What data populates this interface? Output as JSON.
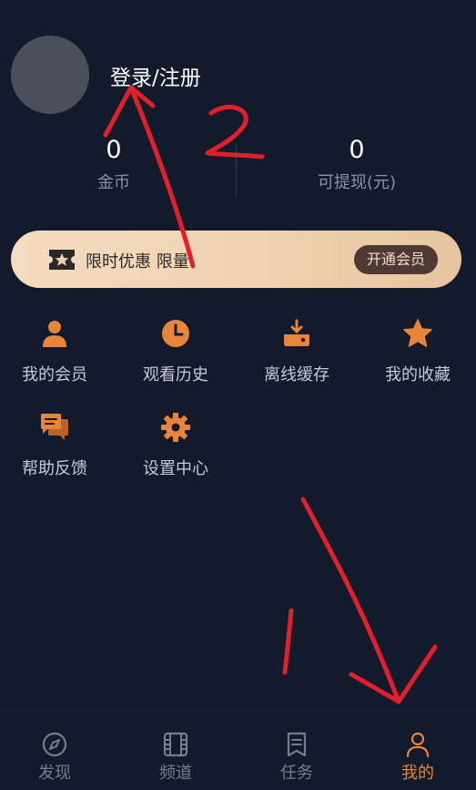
{
  "profile": {
    "login_label": "登录/注册"
  },
  "stats": {
    "coins": {
      "value": "0",
      "label": "金币"
    },
    "cash": {
      "value": "0",
      "label": "可提现(元)"
    }
  },
  "banner": {
    "promo_text": "限时优惠 限量",
    "button_label": "开通会员"
  },
  "menu": [
    {
      "label": "我的会员",
      "icon": "user-icon"
    },
    {
      "label": "观看历史",
      "icon": "clock-icon"
    },
    {
      "label": "离线缓存",
      "icon": "download-icon"
    },
    {
      "label": "我的收藏",
      "icon": "star-icon"
    },
    {
      "label": "帮助反馈",
      "icon": "chat-icon"
    },
    {
      "label": "设置中心",
      "icon": "gear-icon"
    }
  ],
  "tabs": [
    {
      "label": "发现",
      "icon": "compass-icon",
      "active": false
    },
    {
      "label": "频道",
      "icon": "film-icon",
      "active": false
    },
    {
      "label": "任务",
      "icon": "task-icon",
      "active": false
    },
    {
      "label": "我的",
      "icon": "profile-icon",
      "active": true
    }
  ],
  "annotations": {
    "number": "2"
  },
  "colors": {
    "accent": "#e8853a",
    "background": "#121a2b",
    "annotation": "#e0202a"
  }
}
